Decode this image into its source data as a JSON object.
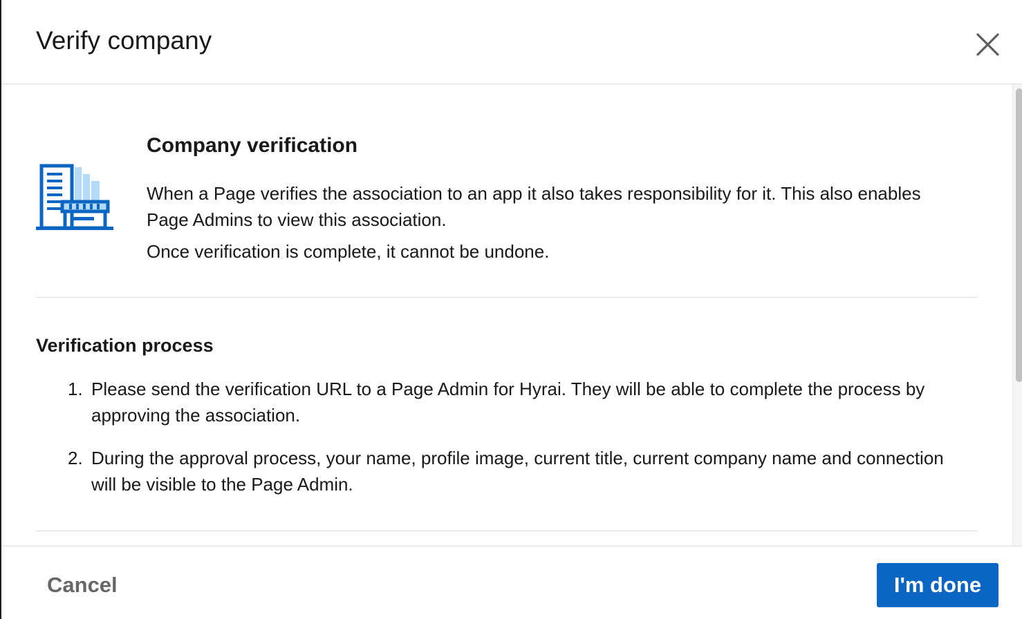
{
  "dialog": {
    "title": "Verify company",
    "close_icon": "close-icon"
  },
  "verification": {
    "icon": "building-icon",
    "heading": "Company verification",
    "description": "When a Page verifies the association to an app it also takes responsibility for it. This also enables Page Admins to view this association.",
    "note": "Once verification is complete, it cannot be undone."
  },
  "process": {
    "heading": "Verification process",
    "steps": [
      {
        "number": "1.",
        "text": "Please send the verification URL to a Page Admin for Hyrai. They will be able to complete the process by approving the association."
      },
      {
        "number": "2.",
        "text": "During the approval process, your name, profile image, current title, current company name and connection will be visible to the Page Admin."
      }
    ]
  },
  "footer": {
    "cancel_label": "Cancel",
    "done_label": "I'm done"
  },
  "colors": {
    "primary": "#0a66c2",
    "icon_dark": "#0a66c2",
    "icon_light": "#b3dbf7",
    "text": "#191919",
    "muted": "#666666"
  }
}
